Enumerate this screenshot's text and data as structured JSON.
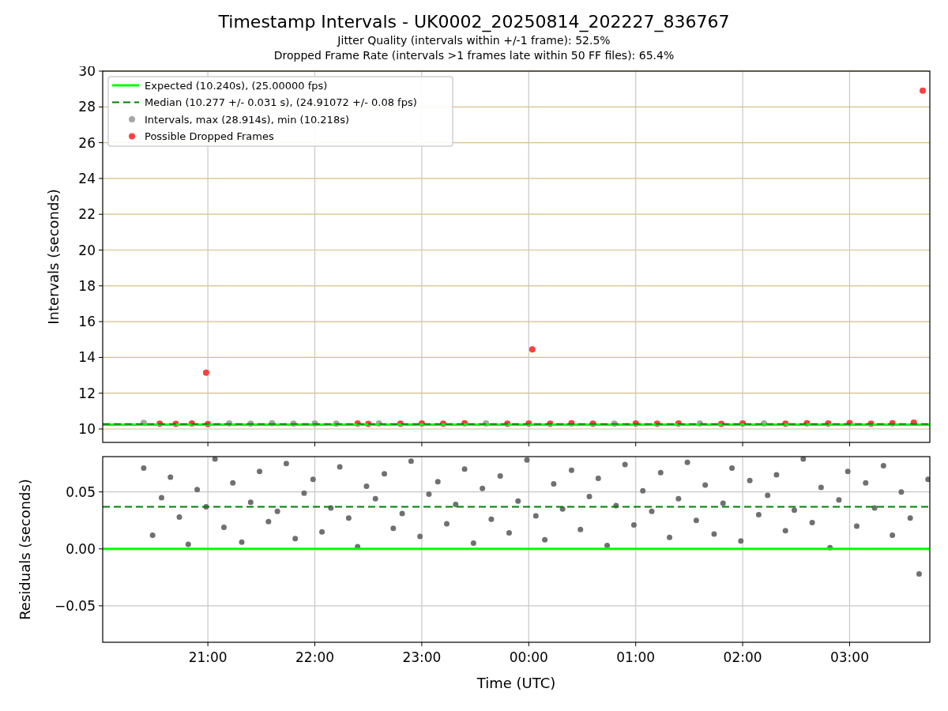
{
  "title": "Timestamp Intervals - UK0002_20250814_202227_836767",
  "subtitle_lines": [
    "Jitter Quality (intervals within +/-1 frame): 52.5%",
    "Dropped Frame Rate (intervals >1 frames late within 50 FF files): 65.4%"
  ],
  "charts": [
    {
      "chart_data": {
        "type": "scatter",
        "ylabel": "Intervals (seconds)",
        "xlim": [
          "2025-08-14T20:01",
          "2025-08-15T03:45"
        ],
        "ylim": [
          9.25,
          30
        ],
        "yticks": [
          10,
          12,
          14,
          16,
          18,
          20,
          22,
          24,
          26,
          28,
          30
        ],
        "grid": true,
        "legend": "upper left",
        "x": [
          "2025-08-14T20:24",
          "2025-08-14T20:33",
          "2025-08-14T20:42",
          "2025-08-14T20:51",
          "2025-08-14T20:59",
          "2025-08-14T21:00",
          "2025-08-14T21:12",
          "2025-08-14T21:24",
          "2025-08-14T21:36",
          "2025-08-14T21:48",
          "2025-08-14T22:00",
          "2025-08-14T22:12",
          "2025-08-14T22:24",
          "2025-08-14T22:30",
          "2025-08-14T22:36",
          "2025-08-14T22:48",
          "2025-08-14T23:00",
          "2025-08-14T23:12",
          "2025-08-14T23:24",
          "2025-08-14T23:36",
          "2025-08-14T23:48",
          "2025-08-15T00:00",
          "2025-08-15T00:02",
          "2025-08-15T00:12",
          "2025-08-15T00:24",
          "2025-08-15T00:36",
          "2025-08-15T00:48",
          "2025-08-15T01:00",
          "2025-08-15T01:12",
          "2025-08-15T01:24",
          "2025-08-15T01:36",
          "2025-08-15T01:48",
          "2025-08-15T02:00",
          "2025-08-15T02:12",
          "2025-08-15T02:24",
          "2025-08-15T02:36",
          "2025-08-15T02:48",
          "2025-08-15T03:00",
          "2025-08-15T03:12",
          "2025-08-15T03:24",
          "2025-08-15T03:36",
          "2025-08-15T03:41"
        ],
        "ref_lines": [
          {
            "axis": "y",
            "value": 10.24,
            "color": "#00ff00",
            "label": "Expected (10.240s), (25.00000 fps)"
          },
          {
            "axis": "y",
            "value": 10.277,
            "color": "#008000",
            "label": "Median (10.277 +/- 0.031 s), (24.91072 +/- 0.08 fps)"
          }
        ],
        "series": [
          {
            "name": "Intervals, max (28.914s), min (10.218s)",
            "color": "#a6a6a6",
            "values": [
              10.34,
              null,
              null,
              null,
              null,
              null,
              10.31,
              10.3,
              10.32,
              10.3,
              10.31,
              10.3,
              null,
              null,
              10.31,
              null,
              null,
              null,
              null,
              10.31,
              null,
              null,
              null,
              null,
              null,
              null,
              10.3,
              null,
              null,
              null,
              10.31,
              null,
              null,
              10.31,
              null,
              null,
              null,
              null,
              null,
              null,
              null,
              null
            ]
          },
          {
            "name": "Possible Dropped Frames",
            "color": "#ff4040",
            "values": [
              null,
              10.3,
              10.29,
              10.31,
              13.15,
              10.28,
              null,
              null,
              null,
              null,
              null,
              null,
              10.31,
              10.29,
              null,
              10.3,
              10.31,
              10.3,
              10.32,
              null,
              10.3,
              10.31,
              14.45,
              10.3,
              10.32,
              10.3,
              null,
              10.31,
              10.3,
              10.31,
              null,
              10.29,
              10.31,
              null,
              10.3,
              10.32,
              10.31,
              10.33,
              10.3,
              10.32,
              10.35,
              28.91
            ]
          }
        ]
      }
    },
    {
      "chart_data": {
        "type": "scatter",
        "xlabel": "Time (UTC)",
        "ylabel": "Residuals (seconds)",
        "xlim": [
          "2025-08-14T20:01",
          "2025-08-15T03:45"
        ],
        "ylim": [
          -0.082,
          0.081
        ],
        "grid": true,
        "xticks": [
          {
            "value": "2025-08-14T21:00",
            "label": "21:00"
          },
          {
            "value": "2025-08-14T22:00",
            "label": "22:00"
          },
          {
            "value": "2025-08-14T23:00",
            "label": "23:00"
          },
          {
            "value": "2025-08-15T00:00",
            "label": "00:00"
          },
          {
            "value": "2025-08-15T01:00",
            "label": "01:00"
          },
          {
            "value": "2025-08-15T02:00",
            "label": "02:00"
          },
          {
            "value": "2025-08-15T03:00",
            "label": "03:00"
          }
        ],
        "yticks": [
          {
            "value": -0.05,
            "label": "−0.05"
          },
          {
            "value": 0,
            "label": "0.00"
          },
          {
            "value": 0.05,
            "label": "0.05"
          }
        ],
        "ref_lines": [
          {
            "axis": "y",
            "value": 0,
            "color": "#00ff00"
          },
          {
            "axis": "y",
            "value": 0.037,
            "color": "#008000"
          }
        ],
        "x": [
          "2025-08-14T20:24",
          "2025-08-14T20:29",
          "2025-08-14T20:34",
          "2025-08-14T20:39",
          "2025-08-14T20:44",
          "2025-08-14T20:49",
          "2025-08-14T20:54",
          "2025-08-14T20:59",
          "2025-08-14T21:04",
          "2025-08-14T21:09",
          "2025-08-14T21:14",
          "2025-08-14T21:19",
          "2025-08-14T21:24",
          "2025-08-14T21:29",
          "2025-08-14T21:34",
          "2025-08-14T21:39",
          "2025-08-14T21:44",
          "2025-08-14T21:49",
          "2025-08-14T21:54",
          "2025-08-14T21:59",
          "2025-08-14T22:04",
          "2025-08-14T22:09",
          "2025-08-14T22:14",
          "2025-08-14T22:19",
          "2025-08-14T22:24",
          "2025-08-14T22:29",
          "2025-08-14T22:34",
          "2025-08-14T22:39",
          "2025-08-14T22:44",
          "2025-08-14T22:49",
          "2025-08-14T22:54",
          "2025-08-14T22:59",
          "2025-08-14T23:04",
          "2025-08-14T23:09",
          "2025-08-14T23:14",
          "2025-08-14T23:19",
          "2025-08-14T23:24",
          "2025-08-14T23:29",
          "2025-08-14T23:34",
          "2025-08-14T23:39",
          "2025-08-14T23:44",
          "2025-08-14T23:49",
          "2025-08-14T23:54",
          "2025-08-14T23:59",
          "2025-08-15T00:04",
          "2025-08-15T00:09",
          "2025-08-15T00:14",
          "2025-08-15T00:19",
          "2025-08-15T00:24",
          "2025-08-15T00:29",
          "2025-08-15T00:34",
          "2025-08-15T00:39",
          "2025-08-15T00:44",
          "2025-08-15T00:49",
          "2025-08-15T00:54",
          "2025-08-15T00:59",
          "2025-08-15T01:04",
          "2025-08-15T01:09",
          "2025-08-15T01:14",
          "2025-08-15T01:19",
          "2025-08-15T01:24",
          "2025-08-15T01:29",
          "2025-08-15T01:34",
          "2025-08-15T01:39",
          "2025-08-15T01:44",
          "2025-08-15T01:49",
          "2025-08-15T01:54",
          "2025-08-15T01:59",
          "2025-08-15T02:04",
          "2025-08-15T02:09",
          "2025-08-15T02:14",
          "2025-08-15T02:19",
          "2025-08-15T02:24",
          "2025-08-15T02:29",
          "2025-08-15T02:34",
          "2025-08-15T02:39",
          "2025-08-15T02:44",
          "2025-08-15T02:49",
          "2025-08-15T02:54",
          "2025-08-15T02:59",
          "2025-08-15T03:04",
          "2025-08-15T03:09",
          "2025-08-15T03:14",
          "2025-08-15T03:19",
          "2025-08-15T03:24",
          "2025-08-15T03:29",
          "2025-08-15T03:34",
          "2025-08-15T03:39",
          "2025-08-15T03:44"
        ],
        "series": [
          {
            "color": "#707070",
            "values": [
              0.071,
              0.012,
              0.045,
              0.063,
              0.028,
              0.004,
              0.052,
              0.037,
              0.079,
              0.019,
              0.058,
              0.006,
              0.041,
              0.068,
              0.024,
              0.033,
              0.075,
              0.009,
              0.049,
              0.061,
              0.015,
              0.036,
              0.072,
              0.027,
              0.002,
              0.055,
              0.044,
              0.066,
              0.018,
              0.031,
              0.077,
              0.011,
              0.048,
              0.059,
              0.022,
              0.039,
              0.07,
              0.005,
              0.053,
              0.026,
              0.064,
              0.014,
              0.042,
              0.078,
              0.029,
              0.008,
              0.057,
              0.035,
              0.069,
              0.017,
              0.046,
              0.062,
              0.003,
              0.038,
              0.074,
              0.021,
              0.051,
              0.033,
              0.067,
              0.01,
              0.044,
              0.076,
              0.025,
              0.056,
              0.013,
              0.04,
              0.071,
              0.007,
              0.06,
              0.03,
              0.047,
              0.065,
              0.016,
              0.034,
              0.079,
              0.023,
              0.054,
              0.001,
              0.043,
              0.068,
              0.02,
              0.058,
              0.036,
              0.073,
              0.012,
              0.05,
              0.027,
              -0.022,
              0.061
            ]
          }
        ]
      }
    }
  ]
}
